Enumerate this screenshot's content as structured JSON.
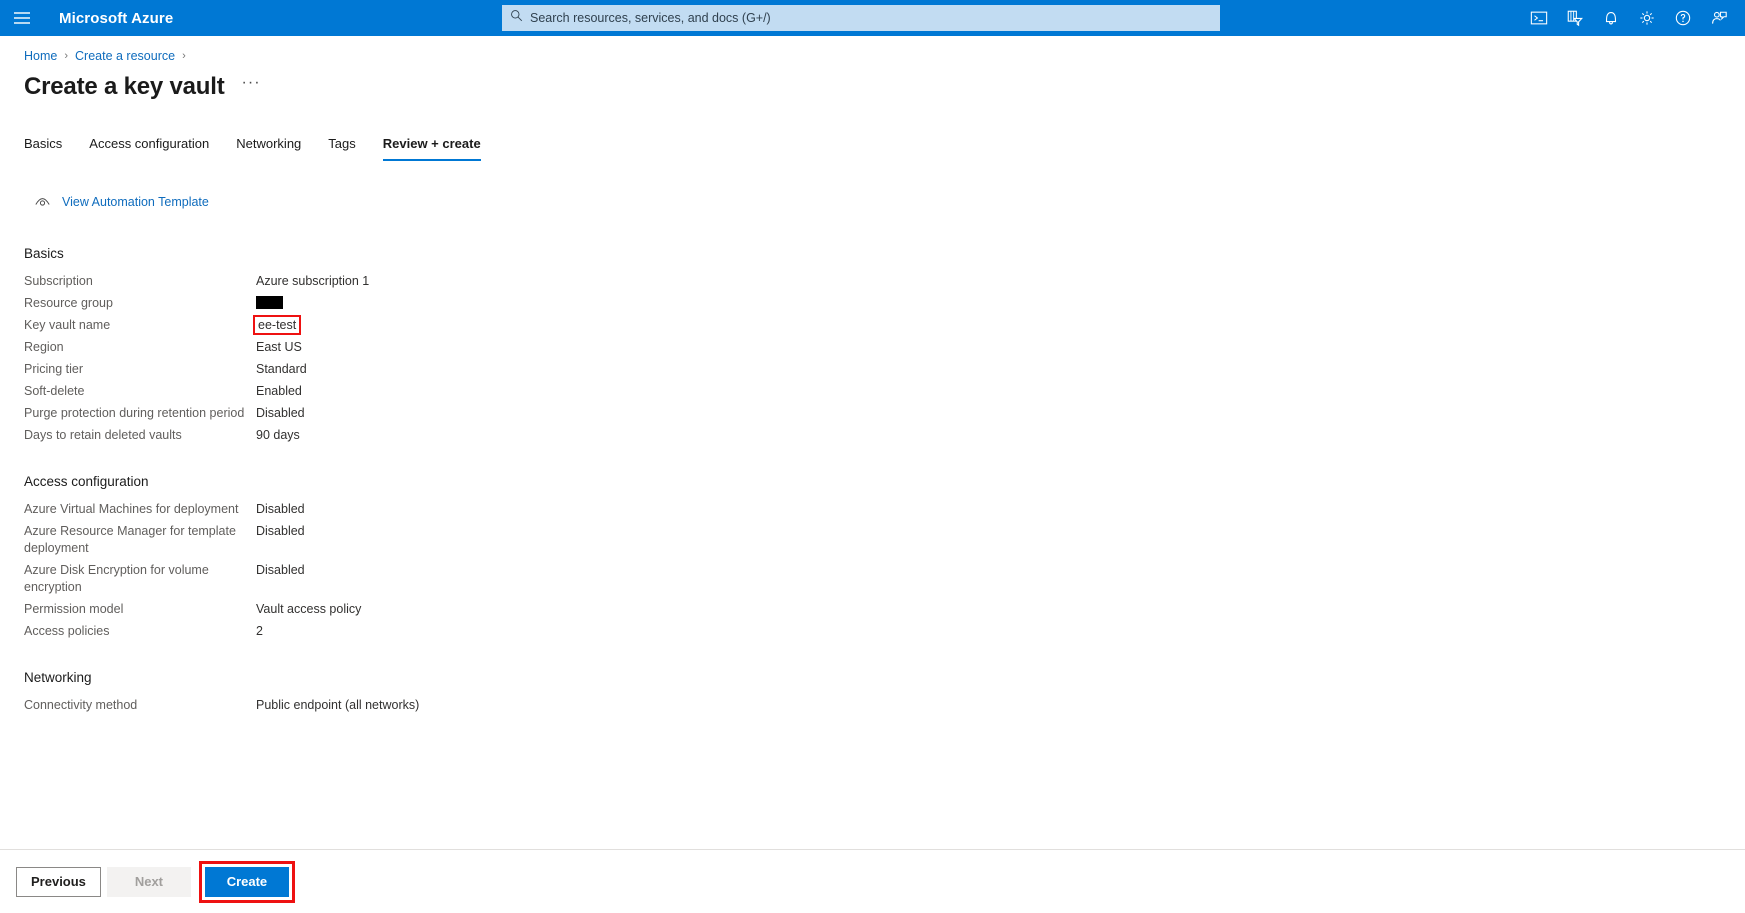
{
  "topbar": {
    "menu_icon": "hamburger-icon",
    "brand": "Microsoft Azure",
    "search": {
      "placeholder": "Search resources, services, and docs (G+/)",
      "value": "",
      "icon": "search-icon"
    },
    "icons": [
      {
        "name": "cloud-shell-icon",
        "label": "Cloud Shell"
      },
      {
        "name": "directories-subscriptions-icon",
        "label": "Directories + subscriptions"
      },
      {
        "name": "notifications-bell-icon",
        "label": "Notifications"
      },
      {
        "name": "settings-gear-icon",
        "label": "Settings"
      },
      {
        "name": "help-question-icon",
        "label": "Help"
      },
      {
        "name": "feedback-person-icon",
        "label": "Feedback"
      }
    ],
    "accent_color": "#0078d4"
  },
  "breadcrumb": {
    "items": [
      {
        "label": "Home"
      },
      {
        "label": "Create a resource"
      }
    ],
    "separator": "›"
  },
  "page": {
    "title": "Create a key vault",
    "more_actions": "···"
  },
  "tabs": [
    {
      "label": "Basics",
      "active": false
    },
    {
      "label": "Access configuration",
      "active": false
    },
    {
      "label": "Networking",
      "active": false
    },
    {
      "label": "Tags",
      "active": false
    },
    {
      "label": "Review + create",
      "active": true
    }
  ],
  "command_bar": {
    "view_automation_template": "View Automation Template",
    "eye_icon": "eye-icon"
  },
  "sections": [
    {
      "title": "Basics",
      "rows": [
        {
          "label": "Subscription",
          "value": "Azure subscription 1",
          "redacted": false,
          "highlighted": false
        },
        {
          "label": "Resource group",
          "value": "",
          "redacted": true,
          "highlighted": false
        },
        {
          "label": "Key vault name",
          "value": "ee-test",
          "redacted": false,
          "highlighted": true
        },
        {
          "label": "Region",
          "value": "East US",
          "redacted": false,
          "highlighted": false
        },
        {
          "label": "Pricing tier",
          "value": "Standard",
          "redacted": false,
          "highlighted": false
        },
        {
          "label": "Soft-delete",
          "value": "Enabled",
          "redacted": false,
          "highlighted": false
        },
        {
          "label": "Purge protection during retention period",
          "value": "Disabled",
          "redacted": false,
          "highlighted": false
        },
        {
          "label": "Days to retain deleted vaults",
          "value": "90 days",
          "redacted": false,
          "highlighted": false
        }
      ]
    },
    {
      "title": "Access configuration",
      "rows": [
        {
          "label": "Azure Virtual Machines for deployment",
          "value": "Disabled",
          "redacted": false,
          "highlighted": false
        },
        {
          "label": "Azure Resource Manager for template deployment",
          "value": "Disabled",
          "redacted": false,
          "highlighted": false
        },
        {
          "label": "Azure Disk Encryption for volume encryption",
          "value": "Disabled",
          "redacted": false,
          "highlighted": false
        },
        {
          "label": "Permission model",
          "value": "Vault access policy",
          "redacted": false,
          "highlighted": false
        },
        {
          "label": "Access policies",
          "value": "2",
          "redacted": false,
          "highlighted": false
        }
      ]
    },
    {
      "title": "Networking",
      "rows": [
        {
          "label": "Connectivity method",
          "value": "Public endpoint (all networks)",
          "redacted": false,
          "highlighted": false
        }
      ]
    }
  ],
  "footer": {
    "previous": "Previous",
    "next": "Next",
    "create": "Create",
    "highlight_color": "#ee1111"
  }
}
